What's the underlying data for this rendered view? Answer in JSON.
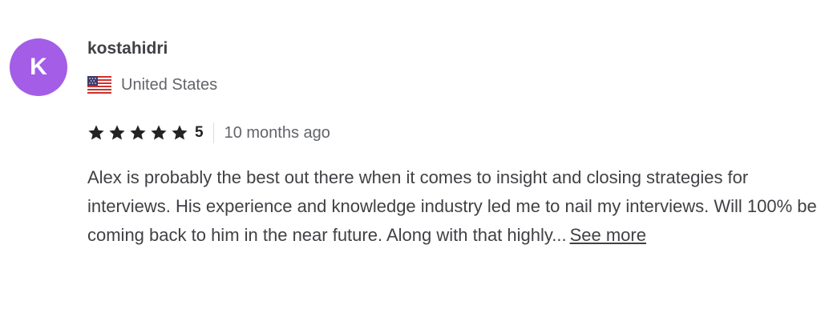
{
  "review": {
    "avatar_letter": "K",
    "avatar_color": "#a45de6",
    "username": "kostahidri",
    "country": "United States",
    "country_flag_icon": "us-flag-icon",
    "rating": 5,
    "rating_text": "5",
    "star_color": "#222325",
    "time_ago": "10 months ago",
    "text": "Alex is probably the best out there when it comes to insight and closing strategies for interviews. His experience and knowledge industry led me to nail my interviews. Will 100% be coming back to him in the near future. Along with that highly...",
    "see_more_label": "See more"
  }
}
